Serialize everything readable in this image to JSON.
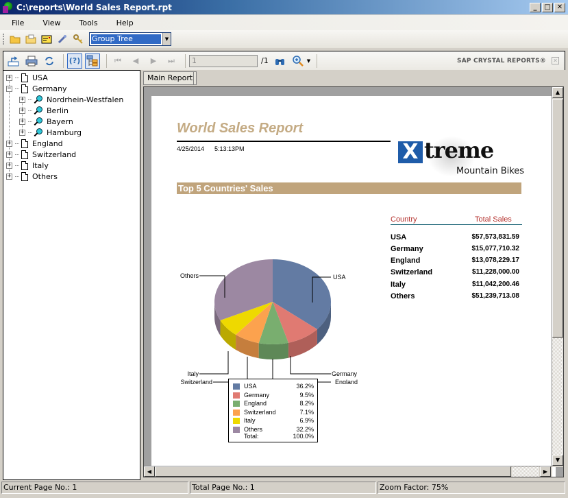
{
  "window": {
    "title": "C:\\reports\\World Sales Report.rpt",
    "controls": {
      "minimize": "_",
      "maximize": "□",
      "close": "✕"
    }
  },
  "menu": [
    "File",
    "View",
    "Tools",
    "Help"
  ],
  "toolbar1": {
    "icons": [
      "open-folder-icon",
      "open-recent-icon",
      "properties-icon",
      "connect-icon",
      "keys-icon"
    ],
    "view_select": {
      "value": "Group Tree"
    }
  },
  "toolbar2": {
    "page_input": "1",
    "page_total": "/1",
    "brand": "SAP CRYSTAL REPORTS®"
  },
  "tree": {
    "items": [
      {
        "label": "USA",
        "expanded": false,
        "children": []
      },
      {
        "label": "Germany",
        "expanded": true,
        "children": [
          "Nordrhein-Westfalen",
          "Berlin",
          "Bayern",
          "Hamburg"
        ]
      },
      {
        "label": "England",
        "expanded": false,
        "children": []
      },
      {
        "label": "Switzerland",
        "expanded": false,
        "children": []
      },
      {
        "label": "Italy",
        "expanded": false,
        "children": []
      },
      {
        "label": "Others",
        "expanded": false,
        "children": []
      }
    ]
  },
  "tabs": [
    {
      "label": "Main Report",
      "active": true
    }
  ],
  "report": {
    "title": "World Sales Report",
    "date": "4/25/2014",
    "time": "5:13:13PM",
    "logo": {
      "mark": "X",
      "word": "treme",
      "tagline": "Mountain Bikes"
    },
    "section_title": "Top 5 Countries' Sales",
    "table": {
      "headers": {
        "country": "Country",
        "sales": "Total Sales"
      },
      "rows": [
        {
          "country": "USA",
          "sales": "$57,573,831.59"
        },
        {
          "country": "Germany",
          "sales": "$15,077,710.32"
        },
        {
          "country": "England",
          "sales": "$13,078,229.17"
        },
        {
          "country": "Switzerland",
          "sales": "$11,228,000.00"
        },
        {
          "country": "Italy",
          "sales": "$11,042,200.46"
        },
        {
          "country": "Others",
          "sales": "$51,239,713.08"
        }
      ]
    },
    "legend_total": {
      "label": "Total:",
      "value": "100.0%"
    }
  },
  "chart_data": {
    "type": "pie",
    "title": "",
    "categories": [
      "USA",
      "Germany",
      "England",
      "Switzerland",
      "Italy",
      "Others"
    ],
    "values": [
      36.2,
      9.5,
      8.2,
      7.1,
      6.9,
      32.2
    ],
    "value_labels": [
      "36.2%",
      "9.5%",
      "8.2%",
      "7.1%",
      "6.9%",
      "32.2%"
    ],
    "colors": [
      "#637ba3",
      "#e07a72",
      "#79ae6f",
      "#fca24e",
      "#eed900",
      "#9c88a2"
    ],
    "style": "3d",
    "legend": "bottom"
  },
  "status": {
    "current_page": "Current Page No.: 1",
    "total_page": "Total Page No.: 1",
    "zoom": "Zoom Factor: 75%"
  }
}
